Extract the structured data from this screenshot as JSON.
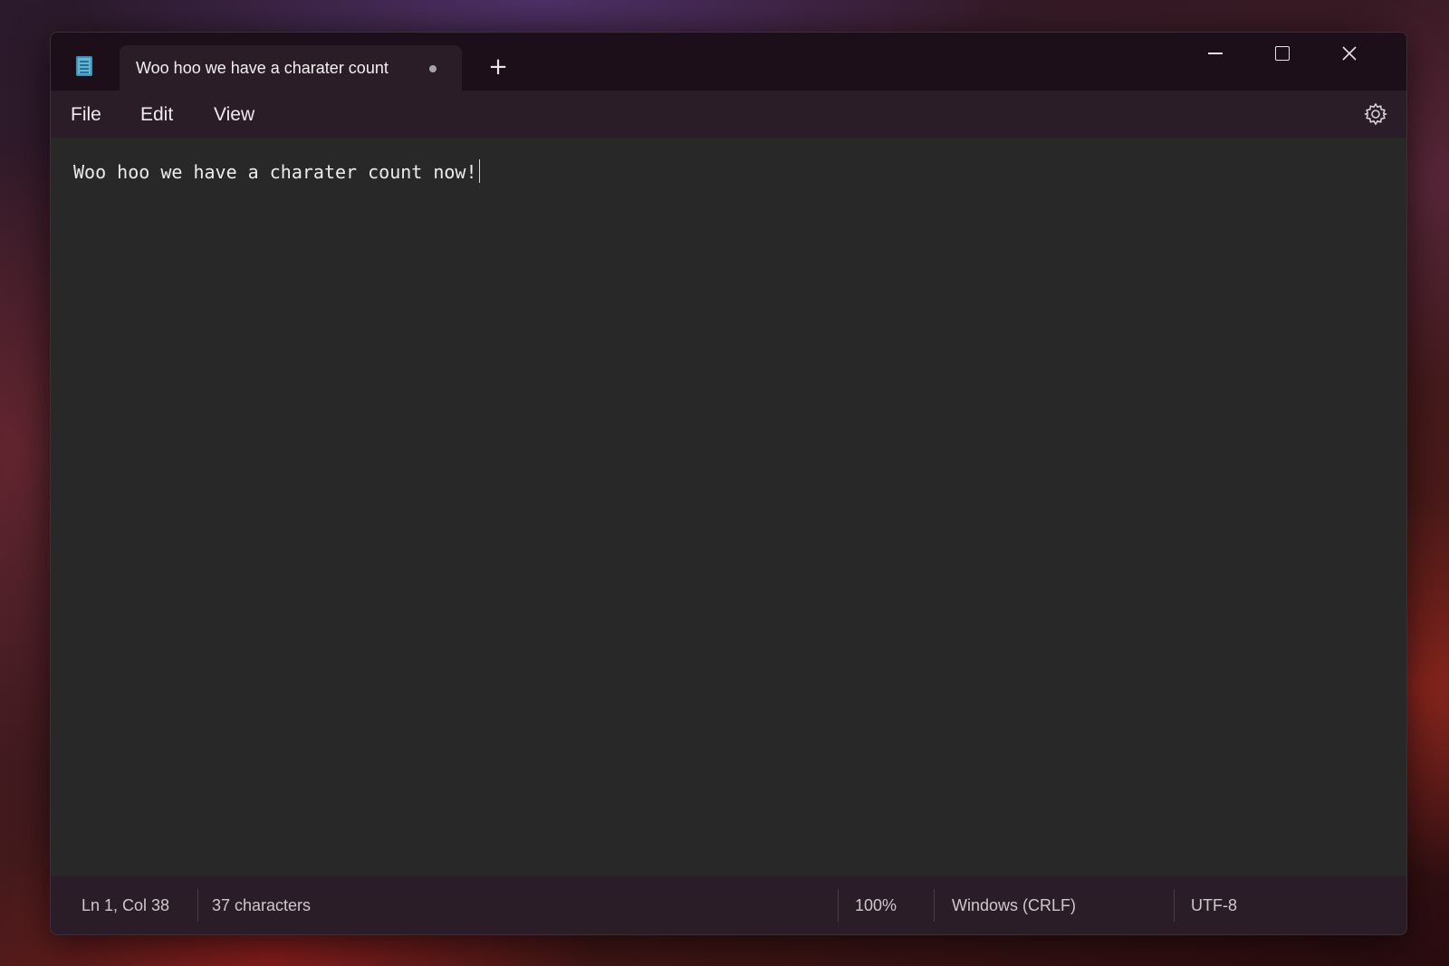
{
  "window": {
    "tab_title": "Woo hoo we have a charater count"
  },
  "menu": {
    "file": "File",
    "edit": "Edit",
    "view": "View"
  },
  "editor": {
    "content": "Woo hoo we have a charater count now!"
  },
  "status": {
    "position": "Ln 1, Col 38",
    "char_count": "37 characters",
    "zoom": "100%",
    "line_ending": "Windows (CRLF)",
    "encoding": "UTF-8"
  },
  "icons": {
    "app": "notepad-icon",
    "new_tab": "plus-icon",
    "minimize": "minimize-icon",
    "maximize": "maximize-icon",
    "close": "close-icon",
    "settings": "gear-icon",
    "unsaved": "unsaved-dot-icon"
  }
}
